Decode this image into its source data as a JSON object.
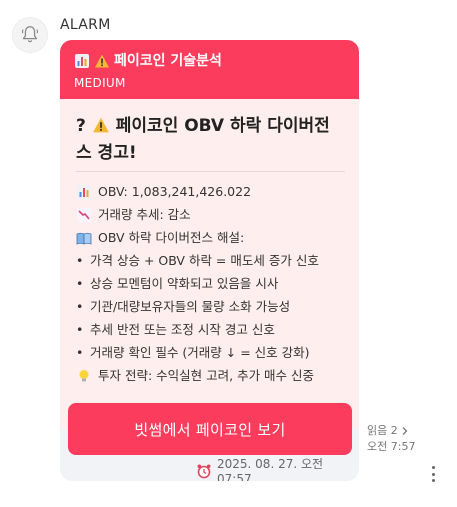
{
  "sender": {
    "name": "ALARM",
    "avatar_icon": "bell-icon"
  },
  "card": {
    "header": {
      "title": "페이코인 기술분석",
      "subtitle": "MEDIUM",
      "color": "#fb3c5c"
    },
    "headline": "? ⚠️ 페이코인 OBV 하락 다이버전스 경고!",
    "headline_parts": {
      "prefix": "?",
      "text": "페이코인 OBV 하락 다이버전스 경고!"
    },
    "lines": [
      {
        "icon": "bar-chart-icon",
        "text": "OBV: 1,083,241,426.022"
      },
      {
        "icon": "chart-decreasing-icon",
        "text": "거래량 추세: 감소"
      },
      {
        "icon": "open-book-icon",
        "text": "OBV 하락 다이버전스 해설:"
      },
      {
        "icon": "bullet",
        "text": "가격 상승 + OBV 하락 = 매도세 증가 신호"
      },
      {
        "icon": "bullet",
        "text": "상승 모멘텀이 약화되고 있음을 시사"
      },
      {
        "icon": "bullet",
        "text": "기관/대량보유자들의 물량 소화 가능성"
      },
      {
        "icon": "bullet",
        "text": "추세 반전 또는 조정 시작 경고 신호"
      },
      {
        "icon": "bullet",
        "text": "거래량 확인 필수 (거래량 ↓ = 신호 강화)"
      },
      {
        "icon": "light-bulb-icon",
        "text": "투자 전략: 수익실현 고려, 추가 매수 신중"
      }
    ],
    "cta_label": "빗썸에서 페이코인 보기",
    "timestamp": "2025. 08. 27. 오전 07:57"
  },
  "meta": {
    "read_label": "읽음 2",
    "time": "오전 7:57"
  },
  "colors": {
    "accent": "#fb3c5c",
    "body_bg": "#ffeeee",
    "card_bg": "#f2f3f7"
  }
}
